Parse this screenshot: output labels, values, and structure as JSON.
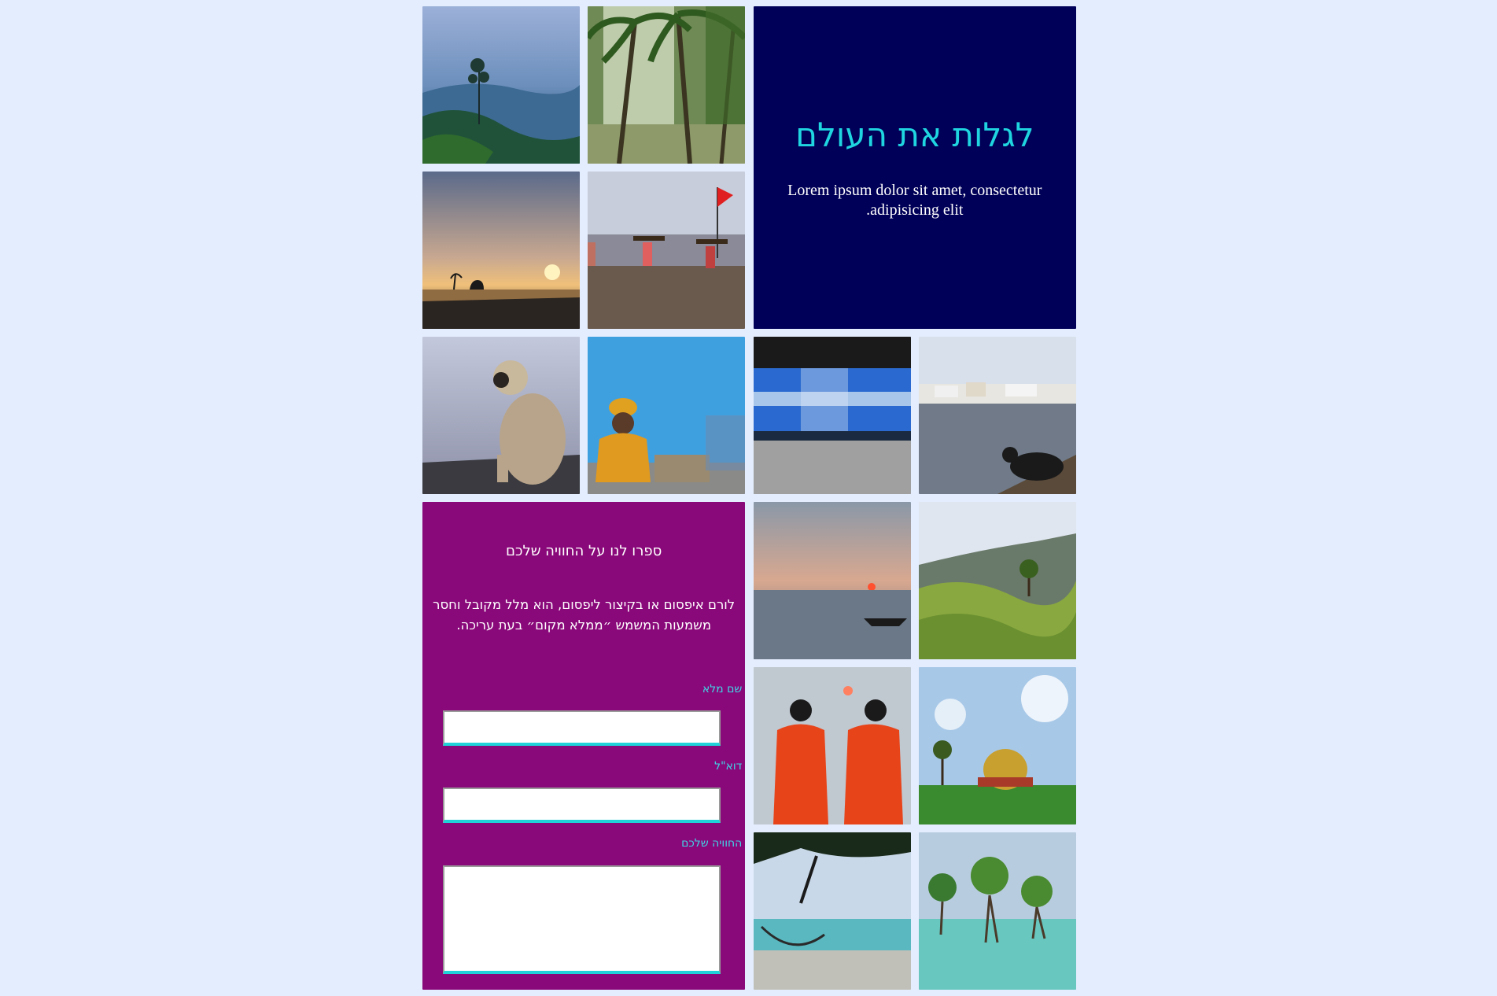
{
  "hero": {
    "title": "לגלות את העולם",
    "text": "Lorem ipsum dolor sit amet, consectetur adipisicing elit."
  },
  "form": {
    "heading": "ספרו לנו על החוויה שלכם",
    "description": "לורם איפסום או בקיצור ליפסום, הוא מלל מקובל וחסר משמעות המשמש ״ממלא מקום״ בעת עריכה.",
    "fields": [
      {
        "label": "שם מלא",
        "value": ""
      },
      {
        "label": "דוא\"ל",
        "value": ""
      },
      {
        "label": "החוויה שלכם",
        "value": ""
      }
    ]
  },
  "photos": [
    {
      "name": "misty-hills-tree-photo"
    },
    {
      "name": "palm-forest-photo"
    },
    {
      "name": "sunset-shore-photo"
    },
    {
      "name": "beach-carriers-flag-photo"
    },
    {
      "name": "langur-monkey-photo"
    },
    {
      "name": "sadhu-blue-wall-photo"
    },
    {
      "name": "blue-train-motion-photo"
    },
    {
      "name": "lake-cow-town-photo"
    },
    {
      "name": "sea-sunset-boat-photo"
    },
    {
      "name": "tea-plantation-hills-photo"
    },
    {
      "name": "women-red-saris-sunrise-photo"
    },
    {
      "name": "golden-dome-photo"
    },
    {
      "name": "beach-hammock-photo"
    },
    {
      "name": "mangrove-trees-water-photo"
    }
  ],
  "colors": {
    "page_background": "#e4edfd",
    "hero_background": "#000058",
    "hero_title": "#1fd6e0",
    "form_background": "#8a097a",
    "form_label": "#3fd6e6",
    "input_underline": "#1fd1d8"
  }
}
